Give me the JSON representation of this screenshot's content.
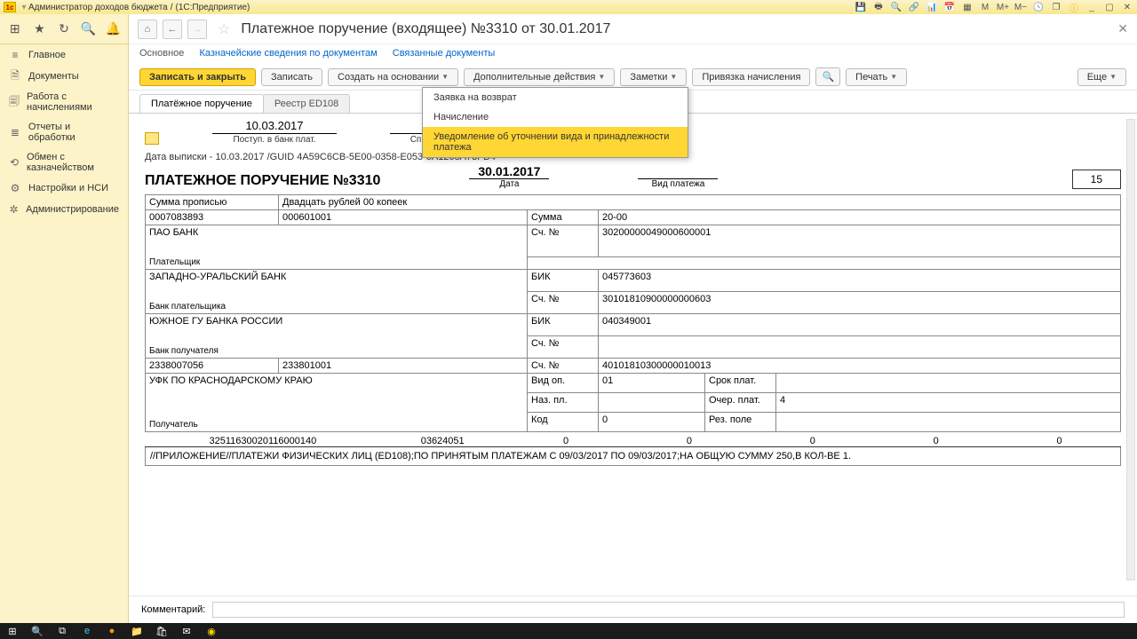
{
  "titlebar": {
    "app": "Администратор доходов бюджета",
    "mode": "(1С:Предприятие)"
  },
  "sidebar": {
    "items": [
      {
        "icon": "≡",
        "label": "Главное"
      },
      {
        "icon": "🗎",
        "label": "Документы"
      },
      {
        "icon": "🗐",
        "label": "Работа с начислениями"
      },
      {
        "icon": "≣",
        "label": "Отчеты и обработки"
      },
      {
        "icon": "⟲",
        "label": "Обмен с казначейством"
      },
      {
        "icon": "⚙",
        "label": "Настройки и НСИ"
      },
      {
        "icon": "✲",
        "label": "Администрирование"
      }
    ]
  },
  "header": {
    "title": "Платежное поручение (входящее) №3310 от 30.01.2017",
    "links": {
      "l0": "Основное",
      "l1": "Казначейские сведения по документам",
      "l2": "Связанные документы"
    }
  },
  "toolbar": {
    "save_close": "Записать и закрыть",
    "save": "Записать",
    "create_based": "Создать на основании",
    "extra": "Дополнительные действия",
    "notes": "Заметки",
    "bind": "Привязка начисления",
    "print": "Печать",
    "more": "Еще"
  },
  "dropdown": {
    "i0": "Заявка на возврат",
    "i1": "Начисление",
    "i2": "Уведомление об уточнении вида и принадлежности платежа"
  },
  "tabs": {
    "t0": "Платёжное поручение",
    "t1": "Реестр ED108"
  },
  "doc": {
    "received_date": "10.03.2017",
    "received_lbl": "Поступ. в банк плат.",
    "writeoff_lbl": "Списано со сч. плат.",
    "guid_line": "Дата выписки - 10.03.2017 /GUID 4A59C6CB-5E00-0358-E053-0A1208A73FD4",
    "title": "ПЛАТЕЖНОЕ ПОРУЧЕНИЕ №3310",
    "date": "30.01.2017",
    "date_lbl": "Дата",
    "paytype_lbl": "Вид платежа",
    "numbox": "15",
    "sum_words_lbl": "Сумма прописью",
    "sum_words": "Двадцать рублей 00 копеек",
    "payer_inn": "0007083893",
    "payer_kpp": "000601001",
    "payer_name": "ПАО БАНК",
    "payer_lbl": "Плательщик",
    "sum_lbl": "Сумма",
    "sum_val": "20-00",
    "acc_lbl": "Сч. №",
    "payer_acc": "30200000049000600001",
    "payer_bank": "ЗАПАДНО-УРАЛЬСКИЙ БАНК",
    "payer_bank_lbl": "Банк плательщика",
    "bik_lbl": "БИК",
    "payer_bik": "045773603",
    "payer_bank_acc": "30101810900000000603",
    "recv_bank": "ЮЖНОЕ ГУ БАНКА РОССИИ",
    "recv_bank_lbl": "Банк получателя",
    "recv_bik": "040349001",
    "recv_inn": "2338007056",
    "recv_kpp": "233801001",
    "recv_acc": "40101810300000010013",
    "recv_name": "УФК ПО КРАСНОДАРСКОМУ КРАЮ",
    "recv_lbl": "Получатель",
    "vidop_lbl": "Вид оп.",
    "vidop": "01",
    "nazpl_lbl": "Наз. пл.",
    "kod_lbl": "Код",
    "kod": "0",
    "srok_lbl": "Срок плат.",
    "ocher_lbl": "Очер. плат.",
    "ocher": "4",
    "rez_lbl": "Рез. поле",
    "codes": {
      "c0": "32511630020116000140",
      "c1": "03624051",
      "c2": "0",
      "c3": "0",
      "c4": "0",
      "c5": "0",
      "c6": "0"
    },
    "purpose": "//ПРИЛОЖЕНИЕ//ПЛАТЕЖИ ФИЗИЧЕСКИХ ЛИЦ (ED108);ПО ПРИНЯТЫМ ПЛАТЕЖАМ С 09/03/2017 ПО 09/03/2017;НА ОБЩУЮ СУММУ 250,В КОЛ-ВЕ 1."
  },
  "comment_lbl": "Комментарий:"
}
